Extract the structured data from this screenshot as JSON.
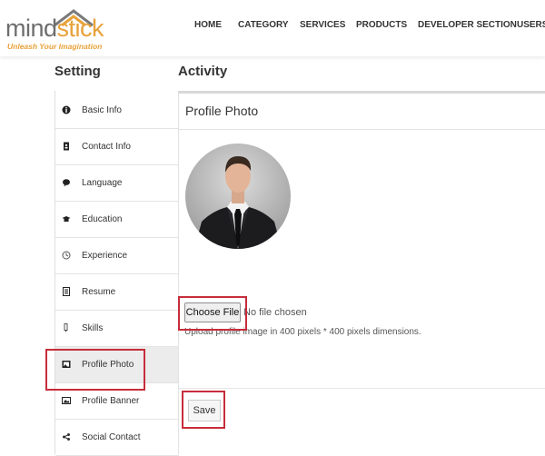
{
  "brand": {
    "word_start": "mind",
    "word_accent": "stick",
    "tagline": "Unleash Your Imagination"
  },
  "nav": {
    "items": [
      "HOME",
      "CATEGORY",
      "SERVICES",
      "PRODUCTS",
      "DEVELOPER SECTION",
      "USERS"
    ]
  },
  "sidebar": {
    "title": "Setting",
    "items": [
      {
        "label": "Basic Info",
        "icon": "info-icon"
      },
      {
        "label": "Contact Info",
        "icon": "contact-card-icon"
      },
      {
        "label": "Language",
        "icon": "speech-bubble-icon"
      },
      {
        "label": "Education",
        "icon": "graduation-cap-icon"
      },
      {
        "label": "Experience",
        "icon": "clock-icon"
      },
      {
        "label": "Resume",
        "icon": "document-icon"
      },
      {
        "label": "Skills",
        "icon": "pencil-icon"
      },
      {
        "label": "Profile Photo",
        "icon": "photo-icon"
      },
      {
        "label": "Profile Banner",
        "icon": "picture-icon"
      },
      {
        "label": "Social Contact",
        "icon": "share-icon"
      }
    ],
    "active_index": 7
  },
  "main": {
    "title": "Activity",
    "panel_title": "Profile Photo",
    "choose_file_label": "Choose File",
    "no_file_text": "No file chosen",
    "hint": "Upload profile image in 400 pixels * 400 pixels dimensions.",
    "save_label": "Save"
  },
  "colors": {
    "accent": "#e8a23a",
    "highlight": "#c62d3b"
  }
}
